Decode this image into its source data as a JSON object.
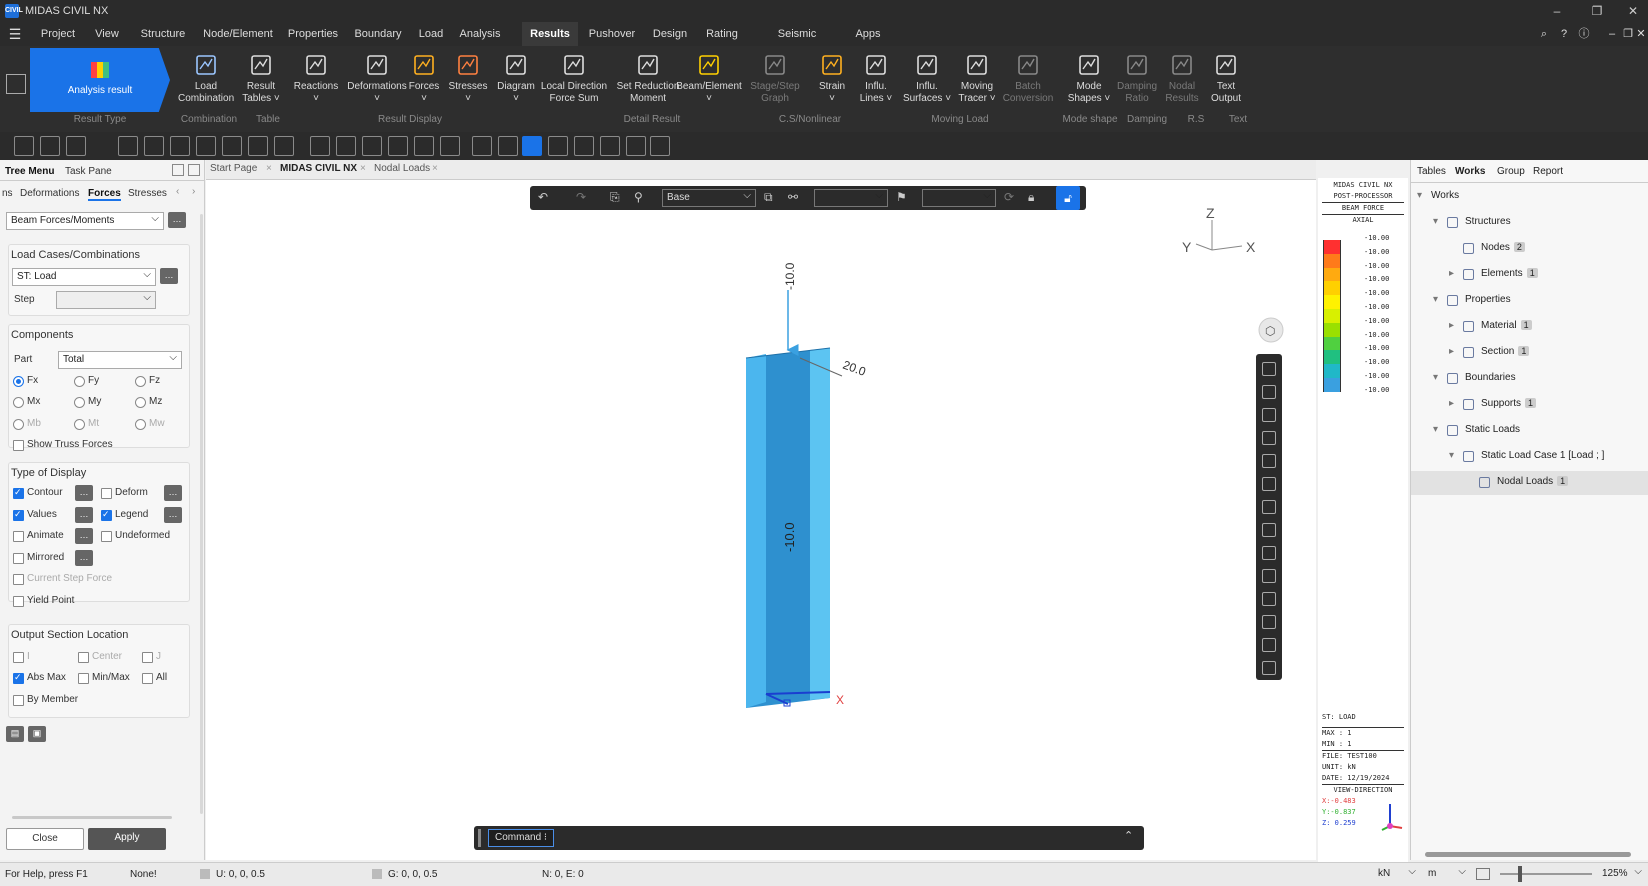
{
  "app": {
    "title": "MIDAS CIVIL NX",
    "logo": "CIVIL"
  },
  "menu": [
    "Project",
    "View",
    "Structure",
    "Node/Element",
    "Properties",
    "Boundary",
    "Load",
    "Analysis",
    "Results",
    "Pushover",
    "Design",
    "Rating",
    "Seismic Perform.",
    "Apps"
  ],
  "ribbon": {
    "analysis_result": "Analysis result",
    "buttons": [
      {
        "l1": "Load",
        "l2": "Combination"
      },
      {
        "l1": "Result",
        "l2": "Tables ˅"
      },
      {
        "l1": "Reactions",
        "l2": "˅"
      },
      {
        "l1": "Deformations",
        "l2": "˅"
      },
      {
        "l1": "Forces",
        "l2": "˅"
      },
      {
        "l1": "Stresses",
        "l2": "˅"
      },
      {
        "l1": "Diagram",
        "l2": "˅"
      },
      {
        "l1": "Local Direction",
        "l2": "Force Sum"
      },
      {
        "l1": "Set Reduction",
        "l2": "Moment"
      },
      {
        "l1": "Beam/Element",
        "l2": "˅"
      },
      {
        "l1": "Stage/Step",
        "l2": "Graph"
      },
      {
        "l1": "Strain",
        "l2": "˅"
      },
      {
        "l1": "Influ.",
        "l2": "Lines ˅"
      },
      {
        "l1": "Influ.",
        "l2": "Surfaces ˅"
      },
      {
        "l1": "Moving",
        "l2": "Tracer ˅"
      },
      {
        "l1": "Batch",
        "l2": "Conversion"
      },
      {
        "l1": "Mode",
        "l2": "Shapes ˅"
      },
      {
        "l1": "Damping",
        "l2": "Ratio"
      },
      {
        "l1": "Nodal",
        "l2": "Results"
      },
      {
        "l1": "Text",
        "l2": "Output"
      }
    ],
    "groups": [
      "Result Type",
      "Combination",
      "Table",
      "Result Display",
      "Detail Result",
      "C.S/Nonlinear",
      "Moving Load",
      "Mode shape",
      "Damping",
      "R.S",
      "Text"
    ]
  },
  "left": {
    "tabs": [
      "Tree Menu",
      "Task Pane"
    ],
    "subtabs": [
      "ns",
      "Deformations",
      "Forces",
      "Stresses"
    ],
    "force_type": "Beam Forces/Moments",
    "load_cases_label": "Load Cases/Combinations",
    "load_case": "ST: Load",
    "step_label": "Step",
    "components_label": "Components",
    "part_label": "Part",
    "part": "Total",
    "components": [
      "Fx",
      "Fy",
      "Fz",
      "Mx",
      "My",
      "Mz",
      "Mb",
      "Mt",
      "Mw"
    ],
    "show_truss": "Show Truss Forces",
    "type_display_label": "Type of Display",
    "display": [
      "Contour",
      "Deform",
      "Values",
      "Legend",
      "Animate",
      "Undeformed",
      "Mirrored",
      "Current Step Force",
      "Yield Point"
    ],
    "output_loc_label": "Output Section Location",
    "output": [
      "I",
      "Center",
      "J",
      "Abs Max",
      "Min/Max",
      "All",
      "By Member"
    ],
    "close": "Close",
    "apply": "Apply"
  },
  "doc_tabs": [
    "Start Page",
    "MIDAS CIVIL NX",
    "Nodal Loads"
  ],
  "viewport": {
    "view_select": "Base",
    "load_label": "-10.0",
    "moment_label": "20.0",
    "value_label": "-10.0",
    "axis_z": "Z",
    "axis_y": "Y",
    "axis_x": "X",
    "local_x": "X"
  },
  "legend": {
    "header": [
      "MIDAS CIVIL NX",
      "POST-PROCESSOR",
      "BEAM FORCE",
      "AXIAL"
    ],
    "values": [
      "-10.00",
      "-10.00",
      "-10.00",
      "-10.00",
      "-10.00",
      "-10.00",
      "-10.00",
      "-10.00",
      "-10.00",
      "-10.00",
      "-10.00",
      "-10.00"
    ],
    "colors": [
      "#ff3030",
      "#ff7a1a",
      "#ffaa10",
      "#ffd000",
      "#fff200",
      "#d8f000",
      "#9ae000",
      "#50d040",
      "#20c080",
      "#20b8c8",
      "#3aa0e0"
    ],
    "info": [
      "ST: LOAD",
      "MAX : 1",
      "MIN : 1",
      "FILE: TEST100",
      "UNIT: kN",
      "DATE: 12/19/2024",
      "VIEW-DIRECTION",
      "X:-0.483",
      "Y:-0.837",
      "Z: 0.259"
    ]
  },
  "right": {
    "tabs": [
      "Tables",
      "Works",
      "Group",
      "Report"
    ],
    "tree": [
      {
        "label": "Works",
        "count": ""
      },
      {
        "label": "Structures",
        "count": ""
      },
      {
        "label": "Nodes",
        "count": "2"
      },
      {
        "label": "Elements",
        "count": "1"
      },
      {
        "label": "Properties",
        "count": ""
      },
      {
        "label": "Material",
        "count": "1"
      },
      {
        "label": "Section",
        "count": "1"
      },
      {
        "label": "Boundaries",
        "count": ""
      },
      {
        "label": "Supports",
        "count": "1"
      },
      {
        "label": "Static Loads",
        "count": ""
      },
      {
        "label": "Static Load Case 1 [Load ; ]",
        "count": ""
      },
      {
        "label": "Nodal Loads",
        "count": "1"
      }
    ]
  },
  "command": {
    "label": "Command",
    "arrow": "⌃"
  },
  "status": {
    "help": "For Help, press F1",
    "none": "None!",
    "u": "U: 0, 0, 0.5",
    "g": "G: 0, 0, 0.5",
    "ne": "N: 0, E: 0",
    "unit_force": "kN",
    "unit_len": "m",
    "zoom": "125%"
  }
}
